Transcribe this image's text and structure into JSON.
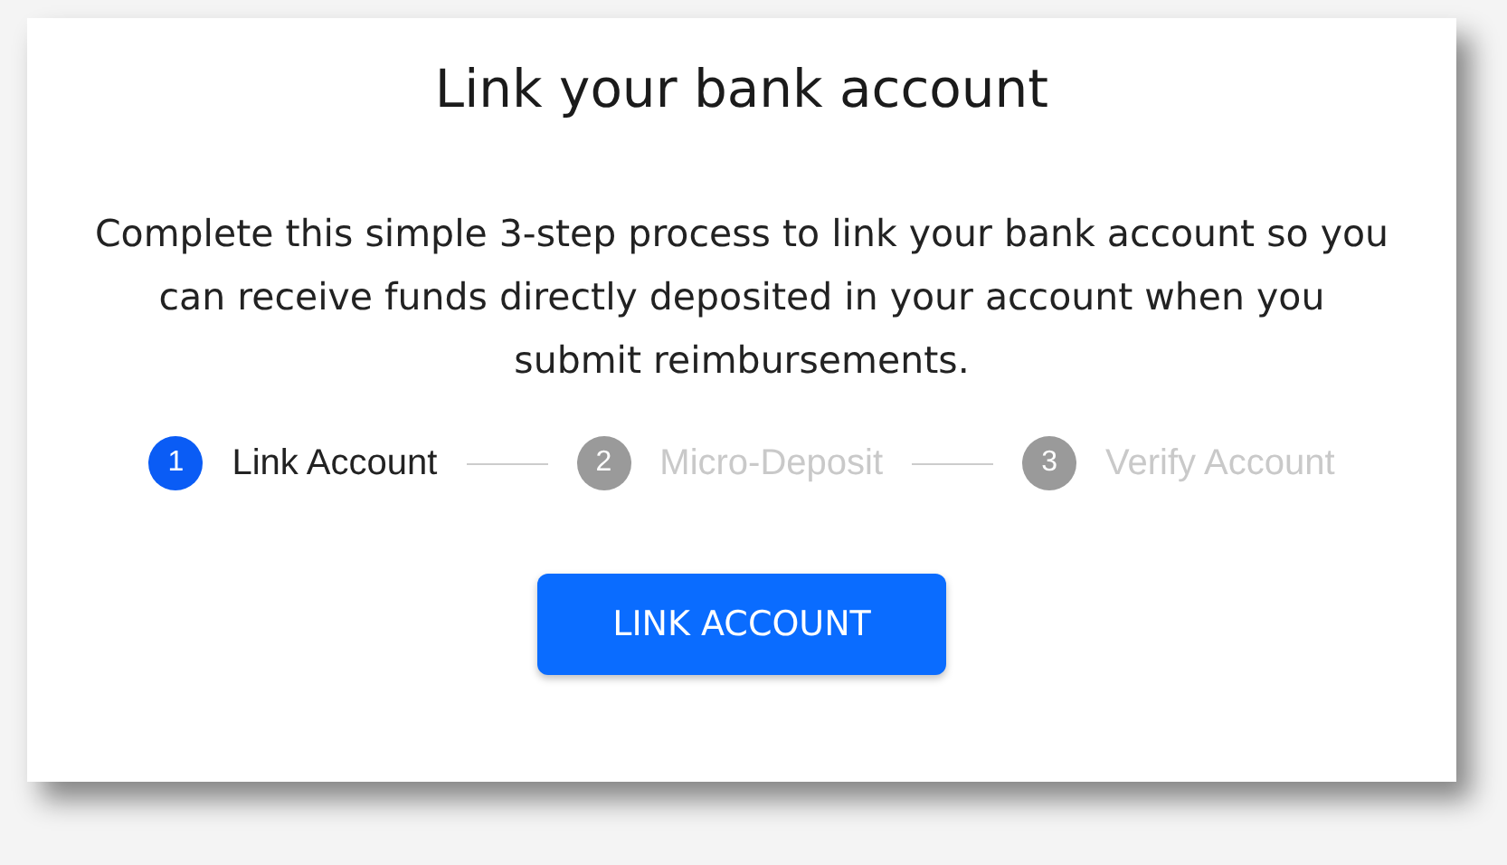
{
  "title": "Link your bank account",
  "description": "Complete this simple 3-step process to link your bank account so you can receive funds directly deposited in your account when you submit reimbursements.",
  "steps": [
    {
      "number": "1",
      "label": "Link Account",
      "selected": true
    },
    {
      "number": "2",
      "label": "Micro-Deposit",
      "selected": false
    },
    {
      "number": "3",
      "label": "Verify Account",
      "selected": false
    }
  ],
  "button": "LINK ACCOUNT"
}
